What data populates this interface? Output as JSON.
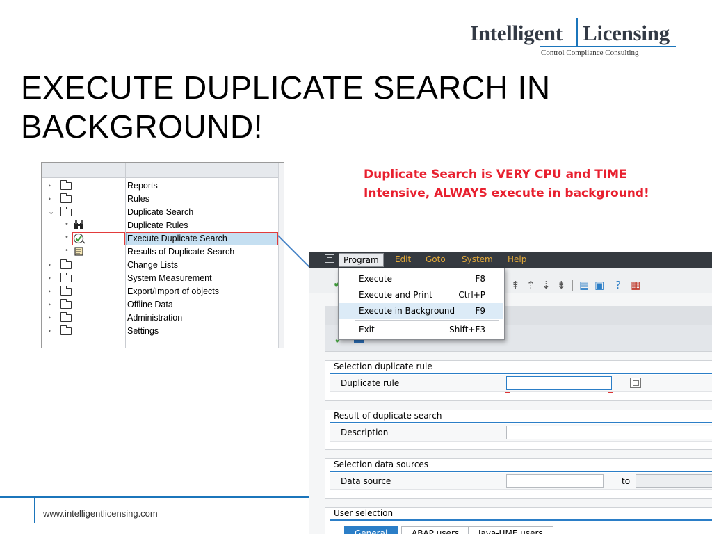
{
  "logo": {
    "word1": "Intelligent",
    "word2": "Licensing",
    "tagline": "Control  Compliance  Consulting",
    "accent_color": "#1b75bb"
  },
  "slide": {
    "title": "EXECUTE DUPLICATE SEARCH IN BACKGROUND!",
    "callout": "Duplicate Search is VERY CPU and TIME Intensive, ALWAYS execute in background!",
    "callout_color": "#e8202f",
    "footer_url": "www.intelligentlicensing.com"
  },
  "tree": {
    "items": [
      {
        "label": "Reports",
        "expander": "›",
        "icon": "folder-icon"
      },
      {
        "label": "Rules",
        "expander": "›",
        "icon": "folder-icon"
      },
      {
        "label": "Duplicate Search",
        "expander": "⌄",
        "icon": "folder-open-icon"
      },
      {
        "label": "Duplicate Rules",
        "expander": "•",
        "icon": "binoculars-icon"
      },
      {
        "label": "Execute Duplicate Search",
        "expander": "•",
        "icon": "execute-search-icon",
        "selected": true
      },
      {
        "label": "Results of Duplicate Search",
        "expander": "•",
        "icon": "scroll-icon"
      },
      {
        "label": "Change Lists",
        "expander": "›",
        "icon": "folder-icon"
      },
      {
        "label": "System Measurement",
        "expander": "›",
        "icon": "folder-icon"
      },
      {
        "label": "Export/Import of objects",
        "expander": "›",
        "icon": "folder-icon"
      },
      {
        "label": "Offline Data",
        "expander": "›",
        "icon": "folder-icon"
      },
      {
        "label": "Administration",
        "expander": "›",
        "icon": "folder-icon"
      },
      {
        "label": "Settings",
        "expander": "›",
        "icon": "folder-icon"
      }
    ]
  },
  "sap": {
    "menu": {
      "program": "Program",
      "edit": "Edit",
      "goto": "Goto",
      "system": "System",
      "help": "Help"
    },
    "dropdown": [
      {
        "label": "Execute",
        "key": "F8"
      },
      {
        "label": "Execute and Print",
        "key": "Ctrl+P"
      },
      {
        "label": "Execute in Background",
        "key": "F9",
        "highlighted": true
      },
      {
        "label": "Exit",
        "key": "Shift+F3"
      }
    ],
    "sections": {
      "selection_rule": {
        "title": "Selection duplicate rule",
        "field": "Duplicate rule",
        "value": ""
      },
      "result": {
        "title": "Result of duplicate search",
        "field": "Description",
        "value": ""
      },
      "data_sources": {
        "title": "Selection data sources",
        "field": "Data source",
        "to": "to",
        "value_from": "",
        "value_to": ""
      },
      "user_selection": {
        "title": "User selection"
      }
    },
    "tabs": [
      "General",
      "ABAP users",
      "Java-UME users"
    ],
    "menu_color": "#e3aa3a",
    "menubar_color": "#353a40",
    "accent_color": "#2b7ec7"
  }
}
